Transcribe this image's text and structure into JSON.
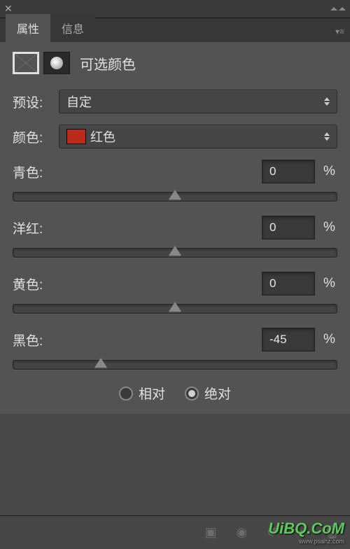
{
  "tabs": {
    "properties": "属性",
    "info": "信息"
  },
  "panel_title": "可选颜色",
  "preset": {
    "label": "预设:",
    "value": "自定"
  },
  "color": {
    "label": "颜色:",
    "value": "红色",
    "swatch": "#b92a1a"
  },
  "sliders": {
    "cyan": {
      "label": "青色:",
      "value": "0",
      "pct": 50
    },
    "magenta": {
      "label": "洋红:",
      "value": "0",
      "pct": 50
    },
    "yellow": {
      "label": "黄色:",
      "value": "0",
      "pct": 50
    },
    "black": {
      "label": "黑色:",
      "value": "-45",
      "pct": 27
    }
  },
  "method": {
    "relative": "相对",
    "absolute": "绝对",
    "selected": "absolute"
  },
  "percent_sign": "%",
  "watermark": "UiBQ.CoM"
}
